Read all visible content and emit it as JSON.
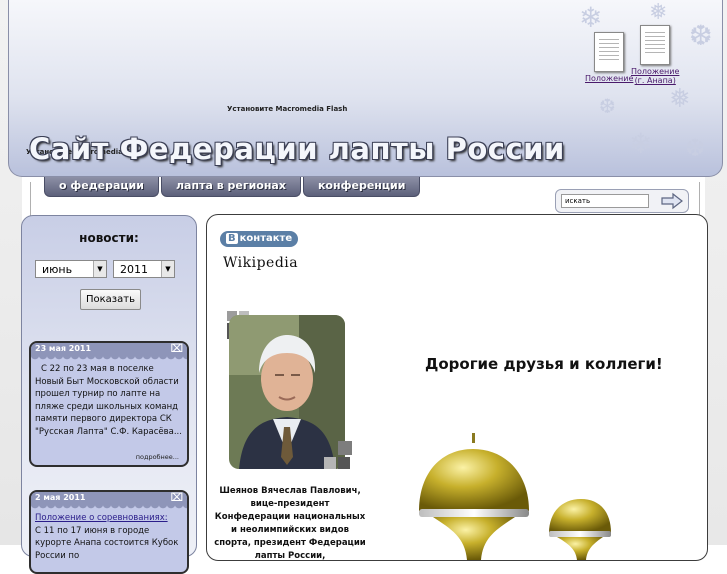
{
  "header": {
    "flash_notice_top": "Установите Macromedia Flash",
    "flash_notice_left": "Установите Macromedia Flash",
    "site_title": "Сайт Федерации лапты России",
    "documents": [
      {
        "label": "Положение"
      },
      {
        "label_line1": "Положение",
        "label_line2": "(г. Анапа)"
      }
    ]
  },
  "nav": {
    "tabs": [
      "о федерации",
      "лапта в регионах",
      "конференции"
    ]
  },
  "search": {
    "value": "искать"
  },
  "news": {
    "title": "новости:",
    "month": "июнь",
    "year": "2011",
    "show_button": "Показать",
    "items": [
      {
        "date": "23 мая 2011",
        "text": "С 22 по 23 мая в поселке Новый Быт Московской области прошел турнир по лапте на пляже среди школьных команд памяти первого директора СК \"Русская Лапта\" С.Ф. Карасёва...",
        "more": "подробнее..."
      },
      {
        "date": "2 мая 2011",
        "link": "Положение о соревнованиях:",
        "text": "С 11 по 17 июня в городе курорте Анапа состоится Кубок России по"
      }
    ]
  },
  "main": {
    "vk_badge_b": "В",
    "vk_badge_text": "контакте",
    "wiki_logo": "Wikipedia",
    "caption": "Шеянов Вячеслав Павлович, вице-президент Конфедерации национальных и неолимпийских видов спорта, президент Федерации лапты России,",
    "greeting": "Дорогие друзья и коллеги!"
  },
  "colors": {
    "header_gradient_end": "#b9c1dc",
    "nav_tab": "#5c607a",
    "news_card": "#c3c9e8",
    "news_card_header": "#8e95b9",
    "vk_blue": "#5b7fa6"
  }
}
